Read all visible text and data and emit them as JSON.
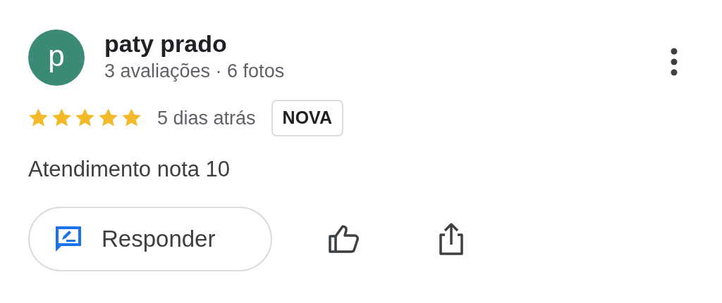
{
  "review": {
    "avatar_letter": "p",
    "author": "paty prado",
    "author_stats": "3 avaliações · 6 fotos",
    "stars": 5,
    "time": "5 dias atrás",
    "badge": "NOVA",
    "text": "Atendimento nota 10"
  },
  "actions": {
    "reply_label": "Responder"
  }
}
